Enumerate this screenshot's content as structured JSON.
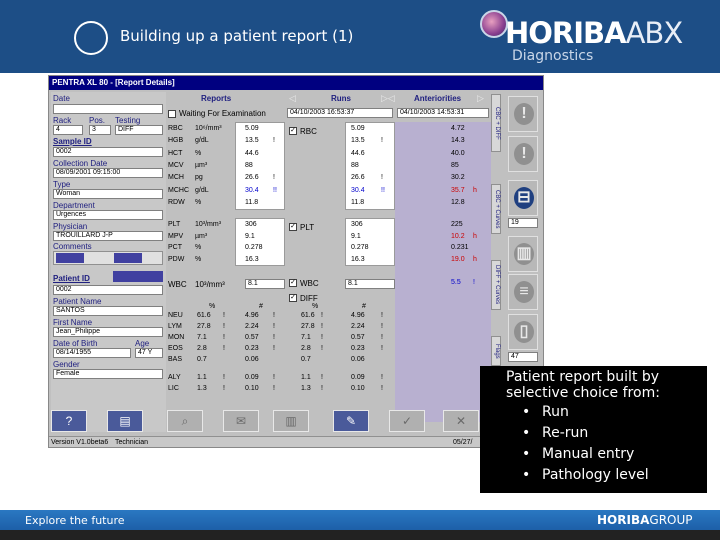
{
  "slide": {
    "title": "Building up a patient report (1)"
  },
  "logo": {
    "brand": "HORIBA",
    "suffix": "ABX",
    "subtitle": "Diagnostics"
  },
  "app": {
    "window_title": "PENTRA XL 80  -  [Report Details]",
    "columns": {
      "reports": "Reports",
      "runs": "Runs",
      "anteriorities": "Anteriorities"
    },
    "waiting_label": "Waiting For Examination",
    "run_dates": [
      "04/10/2003 16:53:37",
      "04/10/2003 14:53:31"
    ],
    "left": {
      "date_label": "Date",
      "rack_label": "Rack",
      "rack_value": "4",
      "pos_label": "Pos.",
      "pos_value": "3",
      "testing_label": "Testing",
      "testing_value": "DIFF",
      "sample_id_label": "Sample ID",
      "sample_id_value": "0002",
      "collection_date_label": "Collection Date",
      "collection_date_value": "08/09/2001 09:15:00",
      "type_label": "Type",
      "type_value": "Woman",
      "department_label": "Department",
      "department_value": "Urgences",
      "physician_label": "Physician",
      "physician_value": "TROUILLARD  J-P",
      "comments_label": "Comments",
      "patient_id_label": "Patient ID",
      "patient_id_value": "0002",
      "patient_name_label": "Patient Name",
      "patient_name_value": "SANTOS",
      "first_name_label": "First Name",
      "first_name_value": "Jean_Philippe",
      "dob_label": "Date of Birth",
      "dob_value": "08/14/1955",
      "age_label": "Age",
      "age_value": "47 Y",
      "gender_label": "Gender",
      "gender_value": "Female"
    },
    "rbc_params": [
      {
        "name": "RBC",
        "unit": "10⁶/mm³",
        "report": "5.09",
        "report_flag": "",
        "run": "5.09",
        "run_flag": "",
        "ant": "4.72",
        "ant_flag": ""
      },
      {
        "name": "HGB",
        "unit": "g/dL",
        "report": "13.5",
        "report_flag": "!",
        "run": "13.5",
        "run_flag": "!",
        "ant": "14.3",
        "ant_flag": ""
      },
      {
        "name": "HCT",
        "unit": "%",
        "report": "44.6",
        "report_flag": "",
        "run": "44.6",
        "run_flag": "",
        "ant": "40.0",
        "ant_flag": ""
      },
      {
        "name": "MCV",
        "unit": "µm³",
        "report": "88",
        "report_flag": "",
        "run": "88",
        "run_flag": "",
        "ant": "85",
        "ant_flag": ""
      },
      {
        "name": "MCH",
        "unit": "pg",
        "report": "26.6",
        "report_flag": "!",
        "run": "26.6",
        "run_flag": "!",
        "ant": "30.2",
        "ant_flag": ""
      },
      {
        "name": "MCHC",
        "unit": "g/dL",
        "report": "30.4",
        "report_flag": "!!",
        "run": "30.4",
        "run_flag": "!!",
        "ant": "35.7",
        "ant_flag": "h"
      },
      {
        "name": "RDW",
        "unit": "%",
        "report": "11.8",
        "report_flag": "",
        "run": "11.8",
        "run_flag": "",
        "ant": "12.8",
        "ant_flag": ""
      }
    ],
    "plt_params": [
      {
        "name": "PLT",
        "unit": "10³/mm³",
        "report": "306",
        "run": "306",
        "ant": "225",
        "ant_flag": ""
      },
      {
        "name": "MPV",
        "unit": "µm³",
        "report": "9.1",
        "run": "9.1",
        "ant": "10.2",
        "ant_flag": "h"
      },
      {
        "name": "PCT",
        "unit": "%",
        "report": "0.278",
        "run": "0.278",
        "ant": "0.231",
        "ant_flag": ""
      },
      {
        "name": "PDW",
        "unit": "%",
        "report": "16.3",
        "run": "16.3",
        "ant": "19.0",
        "ant_flag": "h"
      }
    ],
    "wbc": {
      "name": "WBC",
      "unit": "10³/mm³",
      "report": "8.1",
      "run": "8.1",
      "ant": "5.5",
      "ant_flag": "!"
    },
    "diff_label": "DIFF",
    "diff_headers": {
      "pct": "%",
      "abs": "#"
    },
    "diff_rows": [
      {
        "name": "NEU",
        "pct": "61.6",
        "pct_flag": "!",
        "abs": "4.96",
        "abs_flag": "!"
      },
      {
        "name": "LYM",
        "pct": "27.8",
        "pct_flag": "!",
        "abs": "2.24",
        "abs_flag": "!"
      },
      {
        "name": "MON",
        "pct": "7.1",
        "pct_flag": "!",
        "abs": "0.57",
        "abs_flag": "!"
      },
      {
        "name": "EOS",
        "pct": "2.8",
        "pct_flag": "!",
        "abs": "0.23",
        "abs_flag": "!"
      },
      {
        "name": "BAS",
        "pct": "0.7",
        "pct_flag": "",
        "abs": "0.06",
        "abs_flag": ""
      },
      {
        "name": "ALY",
        "pct": "1.1",
        "pct_flag": "!",
        "abs": "0.09",
        "abs_flag": "!"
      },
      {
        "name": "LIC",
        "pct": "1.3",
        "pct_flag": "!",
        "abs": "0.10",
        "abs_flag": "!"
      }
    ],
    "side_tabs": [
      "CBC + DIFF",
      "CBC + Curves",
      "DIFF + Curves",
      "Flags"
    ],
    "side_numbers": {
      "n19": "19",
      "n47": "47"
    },
    "status": {
      "version": "Version V1.0beta6",
      "user": "Technician",
      "date": "05/27/"
    }
  },
  "bullets": {
    "heading": "Patient report built by selective choice from:",
    "items": [
      "Run",
      "Re-run",
      "Manual entry",
      "Pathology level"
    ]
  },
  "footer": {
    "tagline": "Explore the future",
    "brand": "HORIBA",
    "brand_suffix": "GROUP"
  },
  "colors": {
    "header": "#1d4e86",
    "anteriorities_bg": "#b8b0d0",
    "footer": "#2a78c2"
  }
}
